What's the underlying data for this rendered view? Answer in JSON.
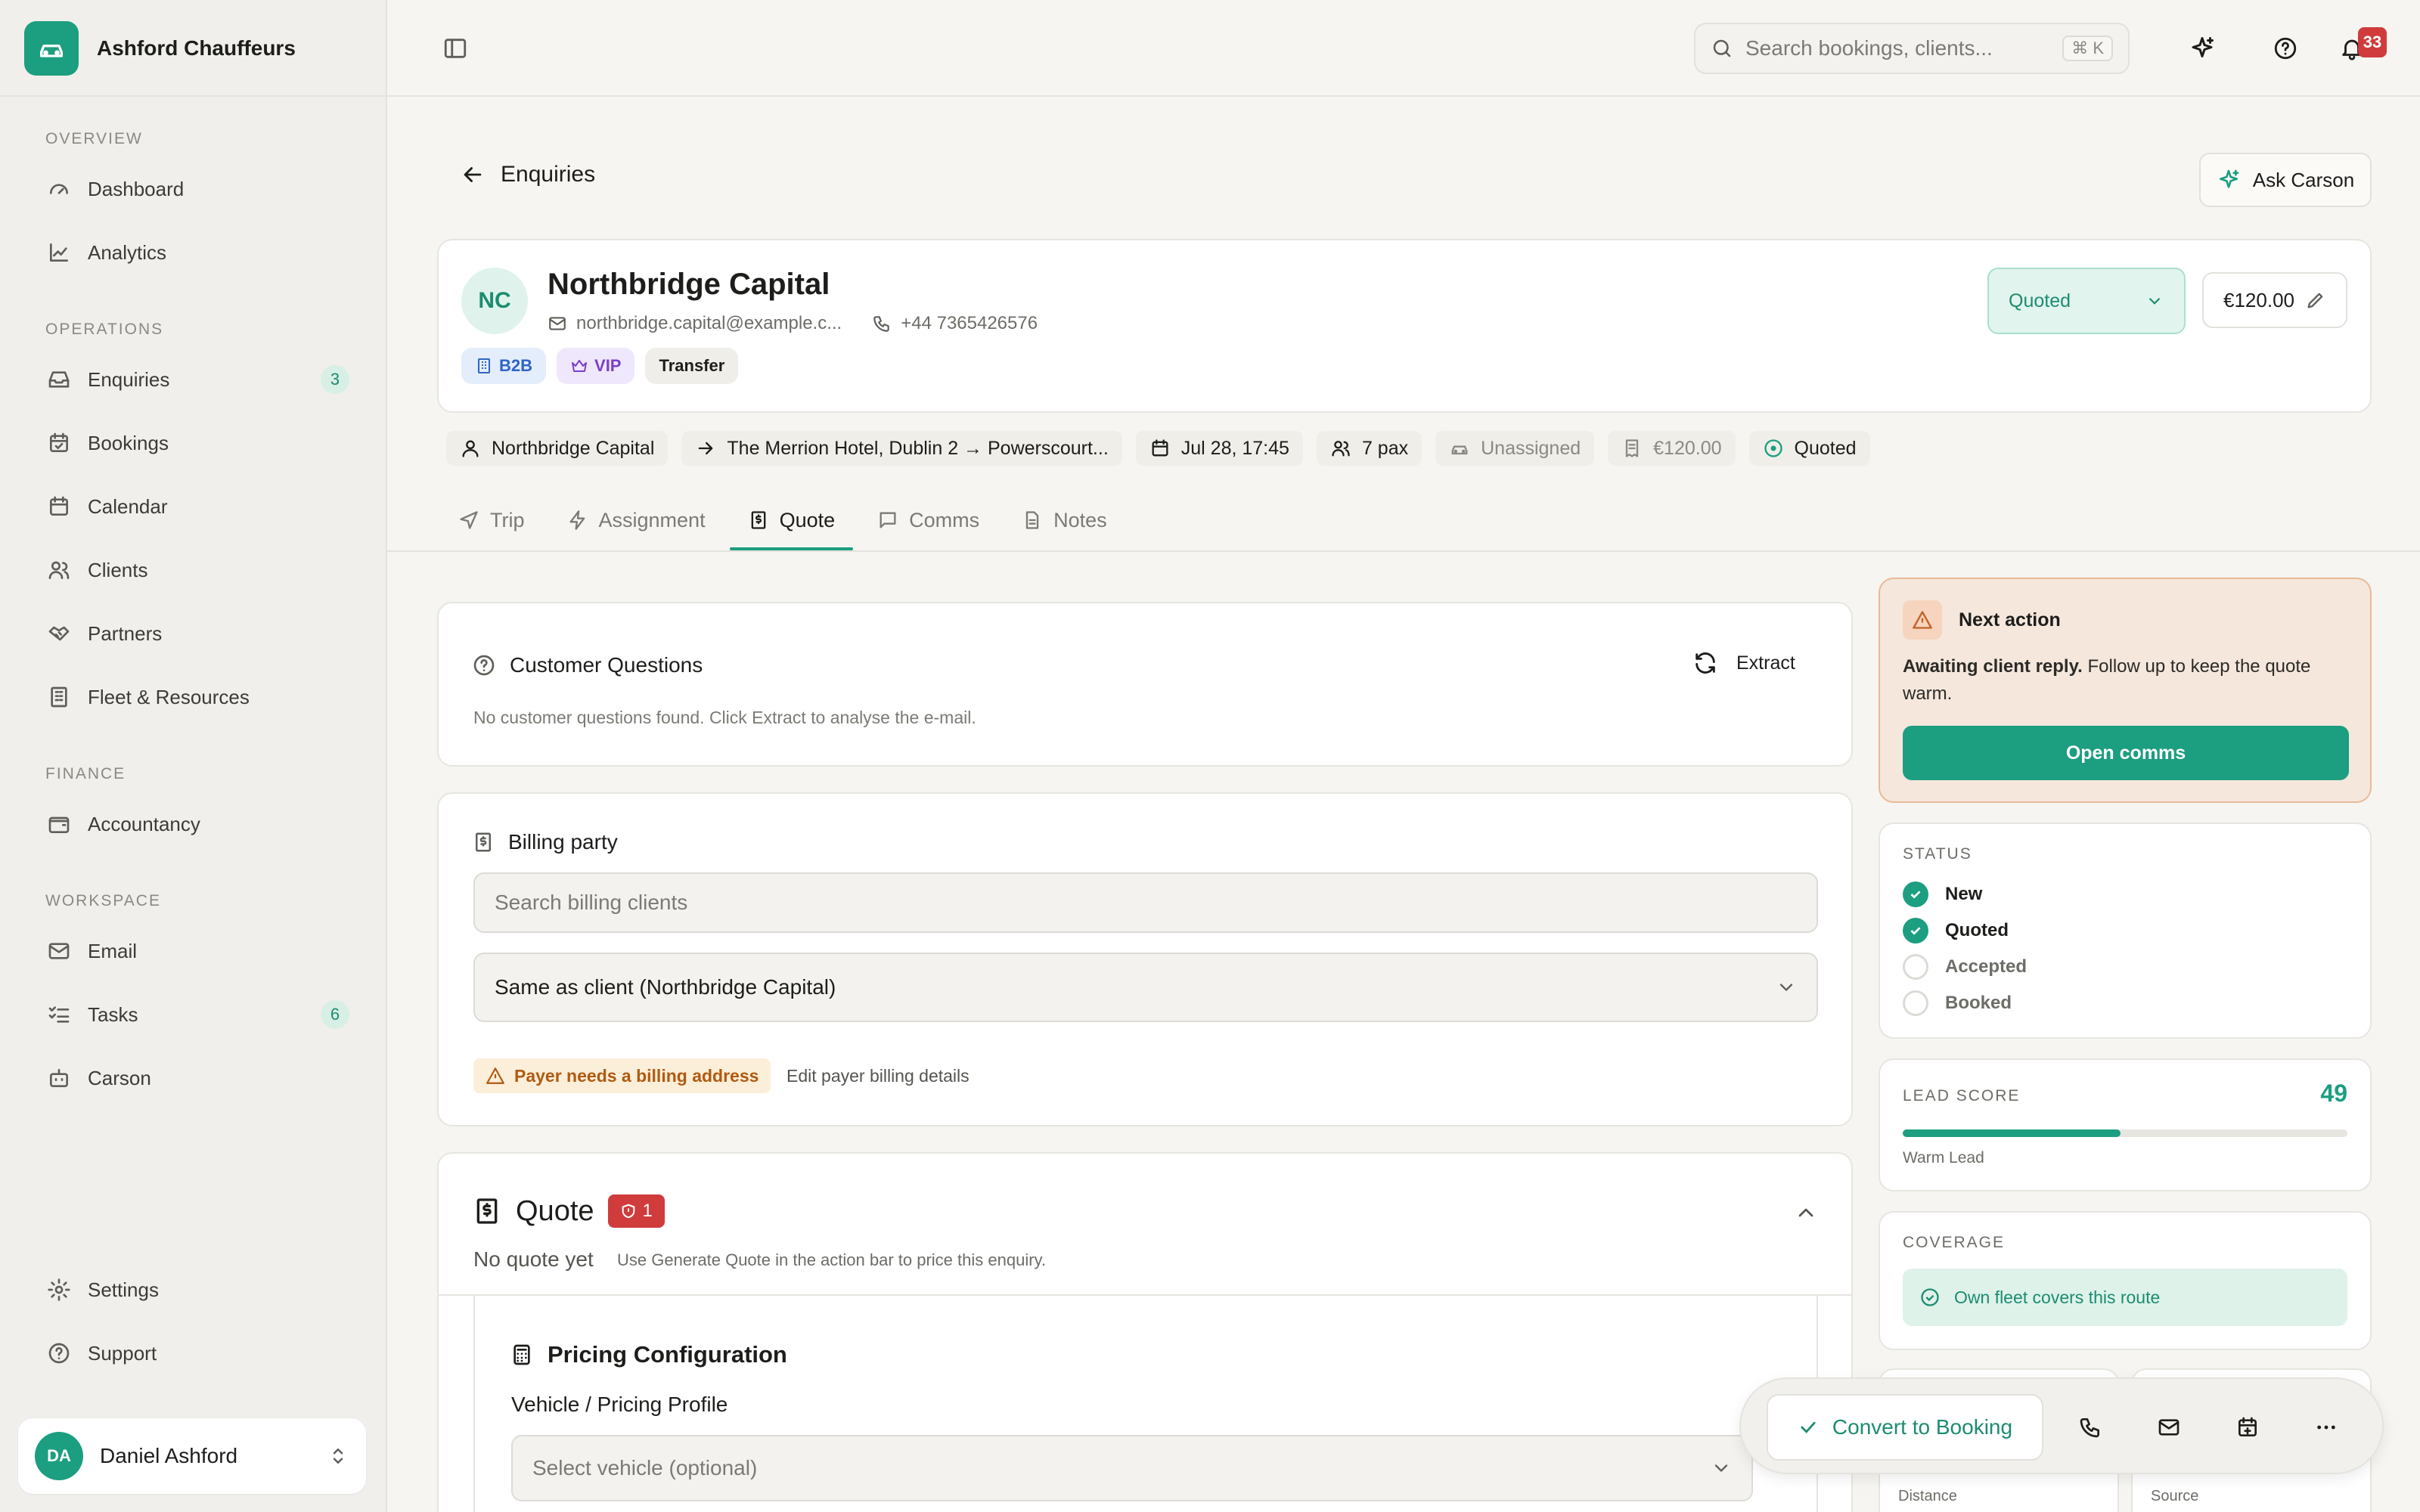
{
  "app": {
    "name": "Ashford Chauffeurs"
  },
  "sidebar": {
    "sections": [
      "Overview",
      "Operations",
      "Finance",
      "Workspace"
    ],
    "items": [
      {
        "label": "Dashboard"
      },
      {
        "label": "Analytics"
      },
      {
        "label": "Enquiries",
        "badge": "3"
      },
      {
        "label": "Bookings"
      },
      {
        "label": "Calendar"
      },
      {
        "label": "Clients"
      },
      {
        "label": "Partners"
      },
      {
        "label": "Fleet & Resources"
      },
      {
        "label": "Accountancy"
      },
      {
        "label": "Email"
      },
      {
        "label": "Tasks",
        "badge": "6"
      },
      {
        "label": "Carson"
      },
      {
        "label": "Settings"
      },
      {
        "label": "Support"
      }
    ],
    "user": {
      "initials": "DA",
      "name": "Daniel Ashford"
    }
  },
  "topbar": {
    "search_placeholder": "Search bookings, clients...",
    "shortcut": "⌘ K",
    "notifications": "33"
  },
  "header": {
    "back_label": "Enquiries",
    "ask_label": "Ask Carson"
  },
  "client": {
    "initials": "NC",
    "name": "Northbridge Capital",
    "email": "northbridge.capital@example.c...",
    "phone": "+44  7365426576",
    "tags": [
      "B2B",
      "VIP",
      "Transfer"
    ],
    "status": "Quoted",
    "price": "€120.00"
  },
  "summary": {
    "client": "Northbridge Capital",
    "route": "The Merrion Hotel, Dublin 2 → Powerscourt...",
    "datetime": "Jul 28, 17:45",
    "pax": "7 pax",
    "driver": "Unassigned",
    "price": "€120.00",
    "status": "Quoted"
  },
  "tabs": [
    "Trip",
    "Assignment",
    "Quote",
    "Comms",
    "Notes"
  ],
  "questions": {
    "title": "Customer Questions",
    "extract_label": "Extract",
    "empty": "No customer questions found. Click Extract to analyse the e-mail."
  },
  "billing": {
    "title": "Billing party",
    "search_placeholder": "Search billing clients",
    "selected": "Same as client (Northbridge Capital)",
    "warning": "Payer needs a billing address",
    "edit_link": "Edit payer billing details"
  },
  "quote": {
    "title": "Quote",
    "badge": "1",
    "status": "No quote yet",
    "hint": "Use Generate Quote in the action bar to price this enquiry.",
    "pricing_title": "Pricing Configuration",
    "vehicle_label": "Vehicle / Pricing Profile",
    "vehicle_placeholder": "Select vehicle (optional)"
  },
  "next_action": {
    "title": "Next action",
    "bold": "Awaiting client reply.",
    "text": " Follow up to keep the quote warm.",
    "button": "Open comms"
  },
  "status_card": {
    "title": "Status",
    "steps": [
      {
        "label": "New",
        "done": true
      },
      {
        "label": "Quoted",
        "done": true
      },
      {
        "label": "Accepted",
        "done": false
      },
      {
        "label": "Booked",
        "done": false
      }
    ]
  },
  "lead": {
    "title": "Lead Score",
    "score": "49",
    "score_fraction": 0.49,
    "label": "Warm Lead"
  },
  "coverage": {
    "title": "Coverage",
    "text": "Own fleet covers this route"
  },
  "stats": {
    "distance_label": "Distance",
    "source_label": "Source"
  },
  "actionbar": {
    "convert_label": "Convert to Booking"
  },
  "colors": {
    "accent": "#1c9e80",
    "danger": "#d03b3b",
    "warning": "#b05a12"
  }
}
